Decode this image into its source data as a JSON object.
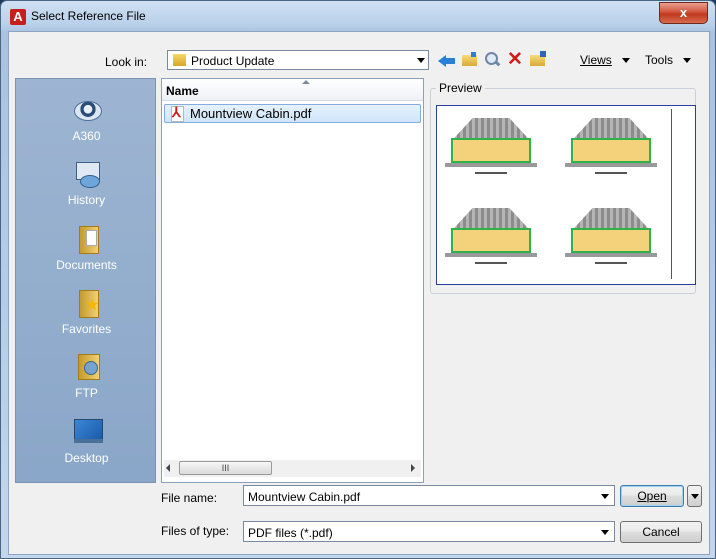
{
  "window": {
    "title": "Select Reference File",
    "app_icon": "A",
    "close_symbol": "x"
  },
  "lookin": {
    "label": "Look in:",
    "value": "Product Update"
  },
  "toolbar": {
    "views_label": "Views",
    "tools_label": "Tools"
  },
  "places": [
    {
      "label": "A360",
      "icon": "a360-icon"
    },
    {
      "label": "History",
      "icon": "history-icon"
    },
    {
      "label": "Documents",
      "icon": "documents-icon"
    },
    {
      "label": "Favorites",
      "icon": "favorites-icon"
    },
    {
      "label": "FTP",
      "icon": "ftp-icon"
    },
    {
      "label": "Desktop",
      "icon": "desktop-icon"
    }
  ],
  "filelist": {
    "column_header": "Name",
    "files": [
      {
        "name": "Mountview Cabin.pdf",
        "selected": true
      }
    ],
    "scroll_thumb": "III"
  },
  "preview": {
    "label": "Preview"
  },
  "filename": {
    "label": "File name:",
    "value": "Mountview Cabin.pdf"
  },
  "filetype": {
    "label": "Files of type:",
    "value": "PDF files (*.pdf)"
  },
  "buttons": {
    "open": "Open",
    "cancel": "Cancel"
  },
  "colors": {
    "selection": "#cfe5fa",
    "places_bg": "#8aa6c8",
    "close": "#c0391f"
  }
}
